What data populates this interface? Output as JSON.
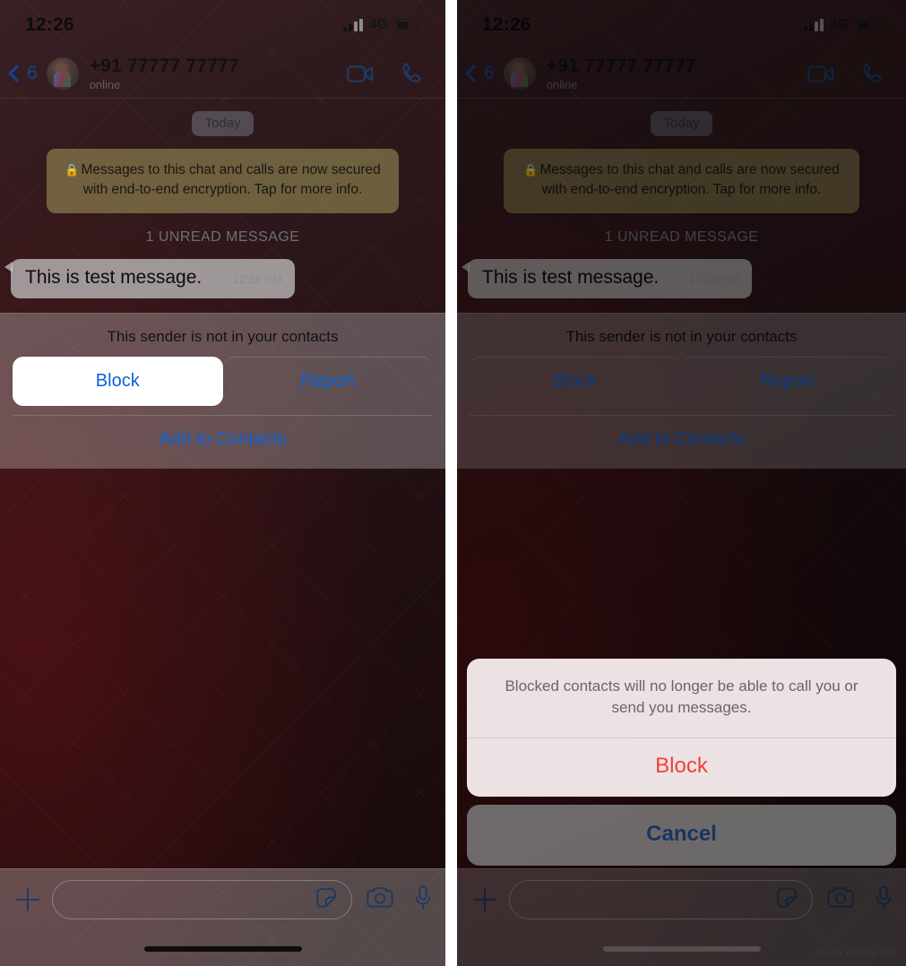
{
  "statusbar": {
    "time": "12:26",
    "network": "4G",
    "signal_icon": "cellular-signal-icon",
    "battery_icon": "battery-icon",
    "battery_level": 58
  },
  "chat_header": {
    "back_label": "6",
    "back_icon": "chevron-left-icon",
    "avatar_icon": "contact-avatar",
    "contact_name": "+91 77777 77777",
    "presence": "online",
    "video_call_icon": "video-camera-icon",
    "voice_call_icon": "phone-icon"
  },
  "conversation": {
    "day_divider": "Today",
    "encryption_notice": "Messages to this chat and calls are now secured with end-to-end encryption. Tap for more info.",
    "encryption_lock_icon": "lock-icon",
    "unread_divider": "1 UNREAD MESSAGE",
    "messages": [
      {
        "text": "This is test message.",
        "time": "12:26 PM",
        "direction": "incoming"
      }
    ]
  },
  "sender_block": {
    "note": "This sender is not in your contacts",
    "block_label": "Block",
    "report_label": "Report",
    "add_contact_label": "Add to Contacts"
  },
  "input_bar": {
    "attach_icon": "plus-icon",
    "message_placeholder": "",
    "sticker_icon": "sticker-icon",
    "camera_icon": "camera-icon",
    "mic_icon": "microphone-icon"
  },
  "action_sheet": {
    "message": "Blocked contacts will no longer be able to call you or send you messages.",
    "confirm_label": "Block",
    "cancel_label": "Cancel"
  },
  "watermark": {
    "text": "www.dataq.com"
  },
  "colors": {
    "accent_blue": "#0a63d6",
    "header_blue": "#1e3a63",
    "destructive_red": "#ef4236",
    "cancel_blue": "#18355f",
    "wallpaper_dark": "#1d0c0e",
    "encryption_bubble": "#968c55"
  }
}
